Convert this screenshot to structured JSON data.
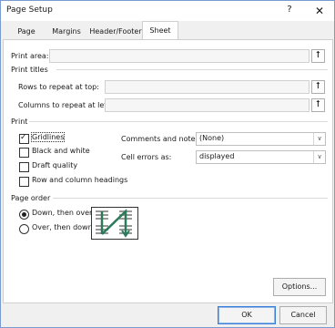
{
  "window": {
    "title": "Page Setup",
    "help": "?",
    "close": "✕"
  },
  "tabs": [
    "Page",
    "Margins",
    "Header/Footer",
    "Sheet"
  ],
  "print_area": {
    "label": "Print area:",
    "value": ""
  },
  "print_titles": {
    "heading": "Print titles",
    "rows_label": "Rows to repeat at top:",
    "cols_label": "Columns to repeat at left:",
    "rows_value": "",
    "cols_value": ""
  },
  "print": {
    "heading": "Print",
    "gridlines": "Gridlines",
    "black_white": "Black and white",
    "draft": "Draft quality",
    "row_col_headings": "Row and column headings",
    "comments_label": "Comments and notes:",
    "comments_value": "(None)",
    "cell_errors_label": "Cell errors as:",
    "cell_errors_value": "displayed"
  },
  "page_order": {
    "heading": "Page order",
    "down_over": "Down, then over",
    "over_down": "Over, then down"
  },
  "buttons": {
    "options": "Options...",
    "ok": "OK",
    "cancel": "Cancel"
  },
  "colors": {
    "accent": "#3c7fd9",
    "arrow_green": "#2b7a5a"
  },
  "icons": {
    "collapse": "collapse-dialog-icon"
  }
}
